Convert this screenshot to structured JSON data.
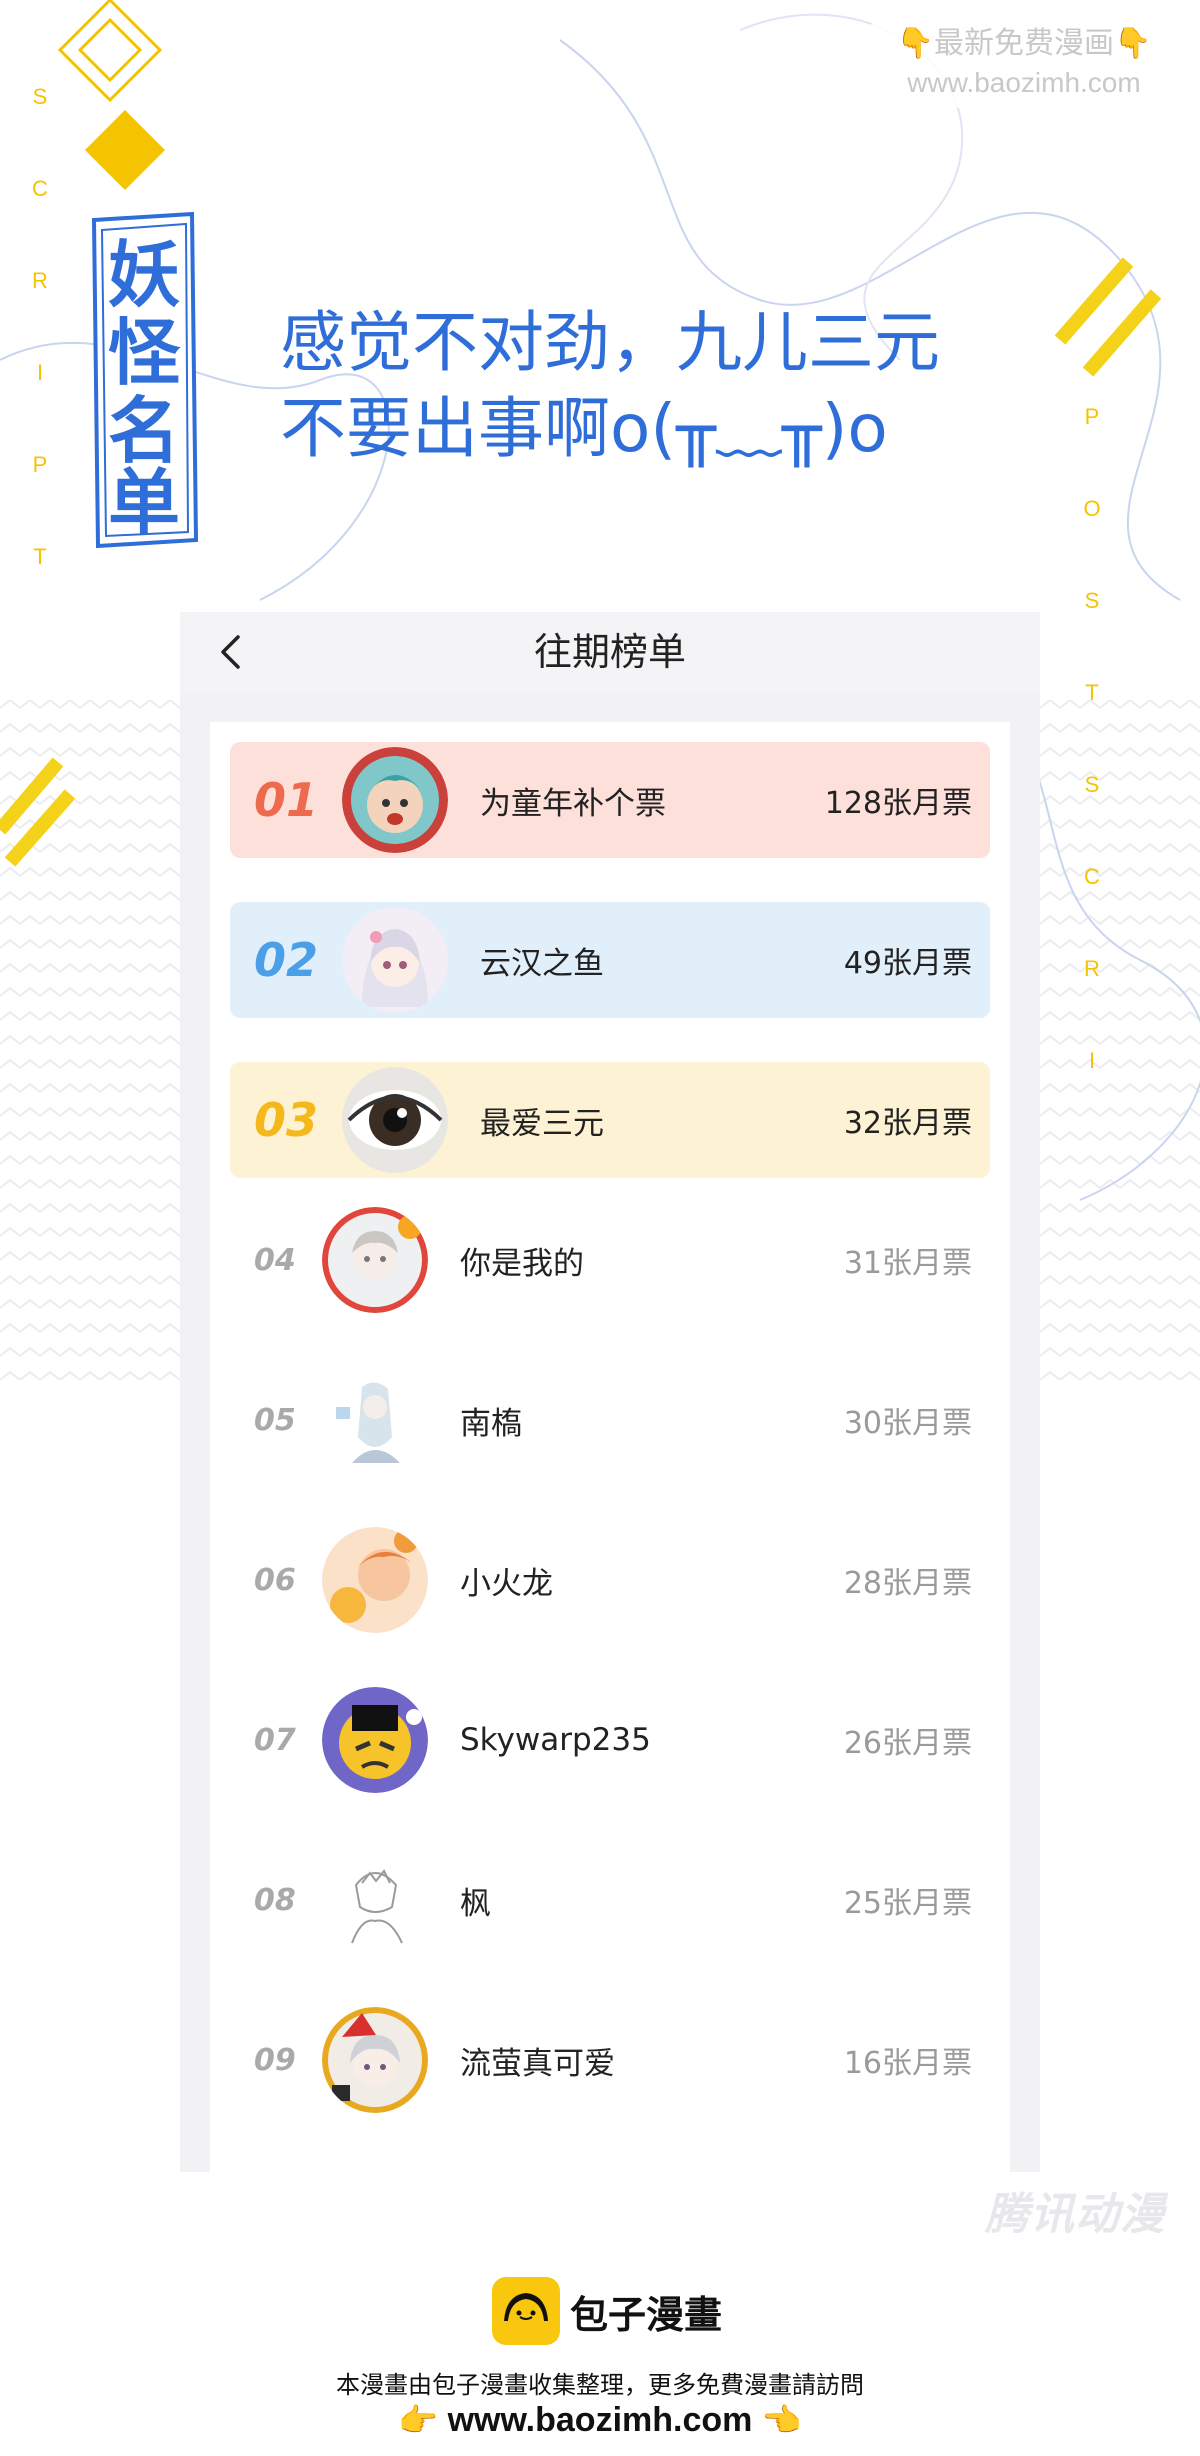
{
  "watermark_top": {
    "line1": "👇最新免费漫画👇",
    "line2": "www.baozimh.com"
  },
  "badge_title": "妖怪名单",
  "side_text_left": [
    "S",
    "C",
    "R",
    "I",
    "P",
    "T"
  ],
  "side_text_right": [
    "P",
    "O",
    "S",
    "T",
    "S",
    "C",
    "R",
    "I"
  ],
  "headline": {
    "line1": "感觉不对劲，九儿三元",
    "line2": "不要出事啊o(╥﹏╥)o"
  },
  "phone": {
    "title": "往期榜单",
    "rows": [
      {
        "rank": "01",
        "name": "为童年补个票",
        "votes": "128张月票"
      },
      {
        "rank": "02",
        "name": "云汉之鱼",
        "votes": "49张月票"
      },
      {
        "rank": "03",
        "name": "最爱三元",
        "votes": "32张月票"
      },
      {
        "rank": "04",
        "name": "你是我的",
        "votes": "31张月票"
      },
      {
        "rank": "05",
        "name": "南槗",
        "votes": "30张月票"
      },
      {
        "rank": "06",
        "name": "小火龙",
        "votes": "28张月票"
      },
      {
        "rank": "07",
        "name": "Skywarp235",
        "votes": "26张月票"
      },
      {
        "rank": "08",
        "name": "枫",
        "votes": "25张月票"
      },
      {
        "rank": "09",
        "name": "流萤真可爱",
        "votes": "16张月票"
      }
    ]
  },
  "tencent_watermark": "腾讯动漫",
  "footer": {
    "brand": "包子漫畫",
    "line": "本漫畫由包子漫畫收集整理，更多免費漫畫請訪問",
    "url": "www.baozimh.com",
    "hand_left": "👉",
    "hand_right": "👈"
  },
  "colors": {
    "accent_blue": "#2f6ed8",
    "accent_yellow": "#f5c400",
    "rank1": "#ee6a4e",
    "rank2": "#4b9fe6",
    "rank3": "#f5b81c"
  }
}
